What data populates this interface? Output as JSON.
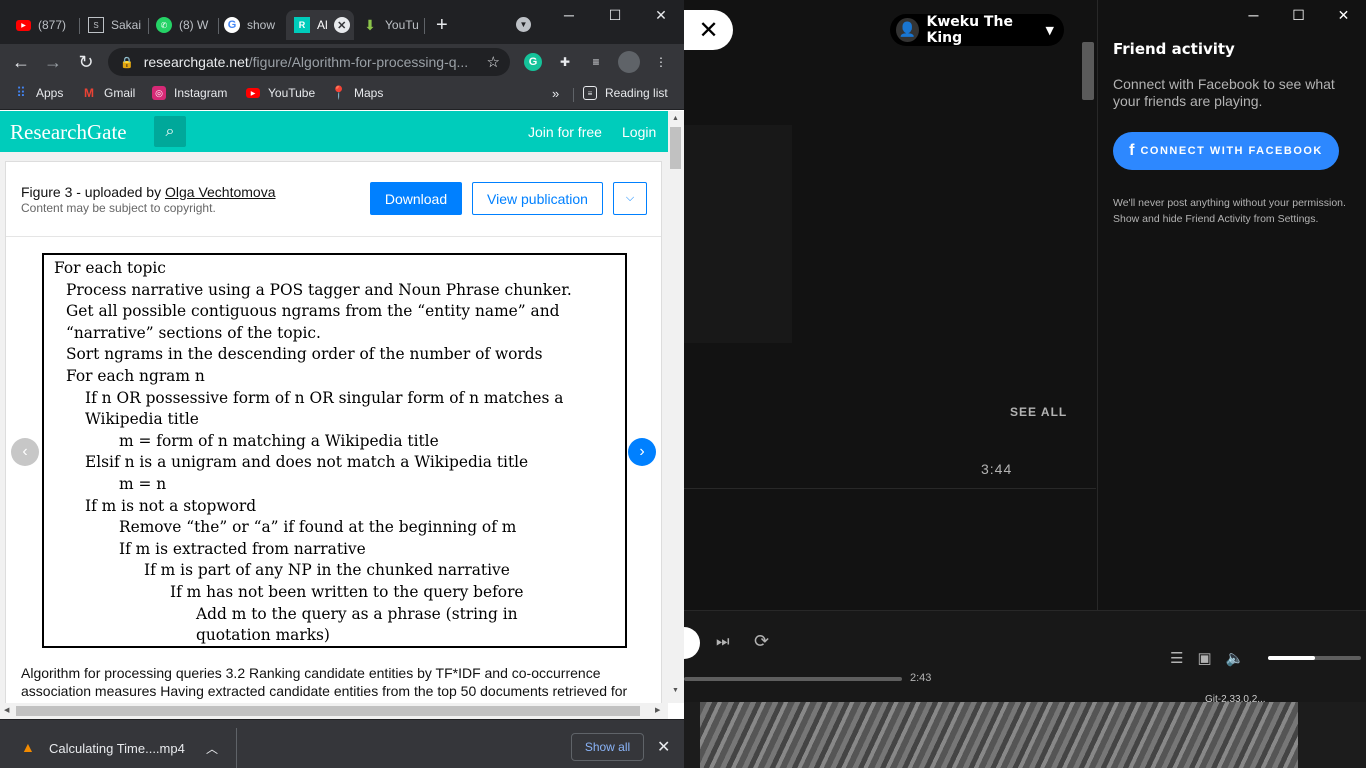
{
  "browser": {
    "tabs": [
      {
        "label": "(877)",
        "icon": "youtube-icon"
      },
      {
        "label": "Sakai",
        "icon": "sakai-icon"
      },
      {
        "label": "(8) W",
        "icon": "whatsapp-icon"
      },
      {
        "label": "show",
        "icon": "google-icon"
      },
      {
        "label": "Al",
        "icon": "researchgate-icon",
        "active": true
      },
      {
        "label": "YouTu",
        "icon": "download-icon"
      }
    ],
    "url_host": "researchgate.net",
    "url_path": "/figure/Algorithm-for-processing-q...",
    "bookmarks": [
      "Apps",
      "Gmail",
      "Instagram",
      "YouTube",
      "Maps"
    ],
    "bookmarks_more": "»",
    "reading_list": "Reading list",
    "grammarly_label": "G"
  },
  "researchgate": {
    "logo": "ResearchGate",
    "join": "Join for free",
    "login": "Login",
    "figure_prefix": "Figure 3 - uploaded by ",
    "uploader": "Olga Vechtomova",
    "copyright": "Content may be subject to copyright.",
    "download": "Download",
    "view_publication": "View publication",
    "algorithm_lines": [
      {
        "indent": 0,
        "text": "For each topic"
      },
      {
        "indent": 1,
        "text": "Process narrative using a POS tagger and Noun Phrase chunker."
      },
      {
        "indent": 1,
        "text": "Get all possible contiguous ngrams from the “entity name” and"
      },
      {
        "indent": 1,
        "text": "“narrative” sections of the topic."
      },
      {
        "indent": 1,
        "text": "Sort ngrams in the descending order of the number of words"
      },
      {
        "indent": 1,
        "text": "For each ngram n"
      },
      {
        "indent": 2,
        "text": "If n OR possessive form of n OR singular form of n matches a"
      },
      {
        "indent": 2,
        "text": "Wikipedia title"
      },
      {
        "indent": 3,
        "text": "m = form of n matching a Wikipedia title"
      },
      {
        "indent": 2,
        "text": "Elsif n is a unigram and does not match a Wikipedia title"
      },
      {
        "indent": 3,
        "text": "m = n"
      },
      {
        "indent": 2,
        "text": "If m is not a stopword"
      },
      {
        "indent": 3,
        "text": "Remove “the” or “a” if found at the beginning of m"
      },
      {
        "indent": 3,
        "text": "If m is extracted from narrative"
      },
      {
        "indent": 4,
        "text": "If m is part of any NP in the chunked narrative"
      },
      {
        "indent": 5,
        "text": "If m has not been written to the query before"
      },
      {
        "indent": 6,
        "text": "Add m to the query as a phrase (string in"
      },
      {
        "indent": 6,
        "text": "quotation marks)"
      }
    ],
    "caption": "Algorithm for processing queries 3.2 Ranking candidate entities by TF*IDF and co-occurrence association measures Having extracted candidate entities from the top 50 documents retrieved for"
  },
  "download_bar": {
    "file": "Calculating Time....mp4",
    "show_all": "Show all"
  },
  "spotify": {
    "user": "Kweku The King",
    "see_all": "SEE ALL",
    "track_time": "3:44",
    "elapsed": "2:43",
    "volume": 0.5,
    "friend_title": "Friend activity",
    "friend_desc": "Connect with Facebook to see what your friends are playing.",
    "connect_button": "CONNECT WITH FACEBOOK",
    "friend_note": "We'll never post anything without your permission. Show and hide Friend Activity from Settings.",
    "bg_text": "Git-2.33.0.2..."
  }
}
